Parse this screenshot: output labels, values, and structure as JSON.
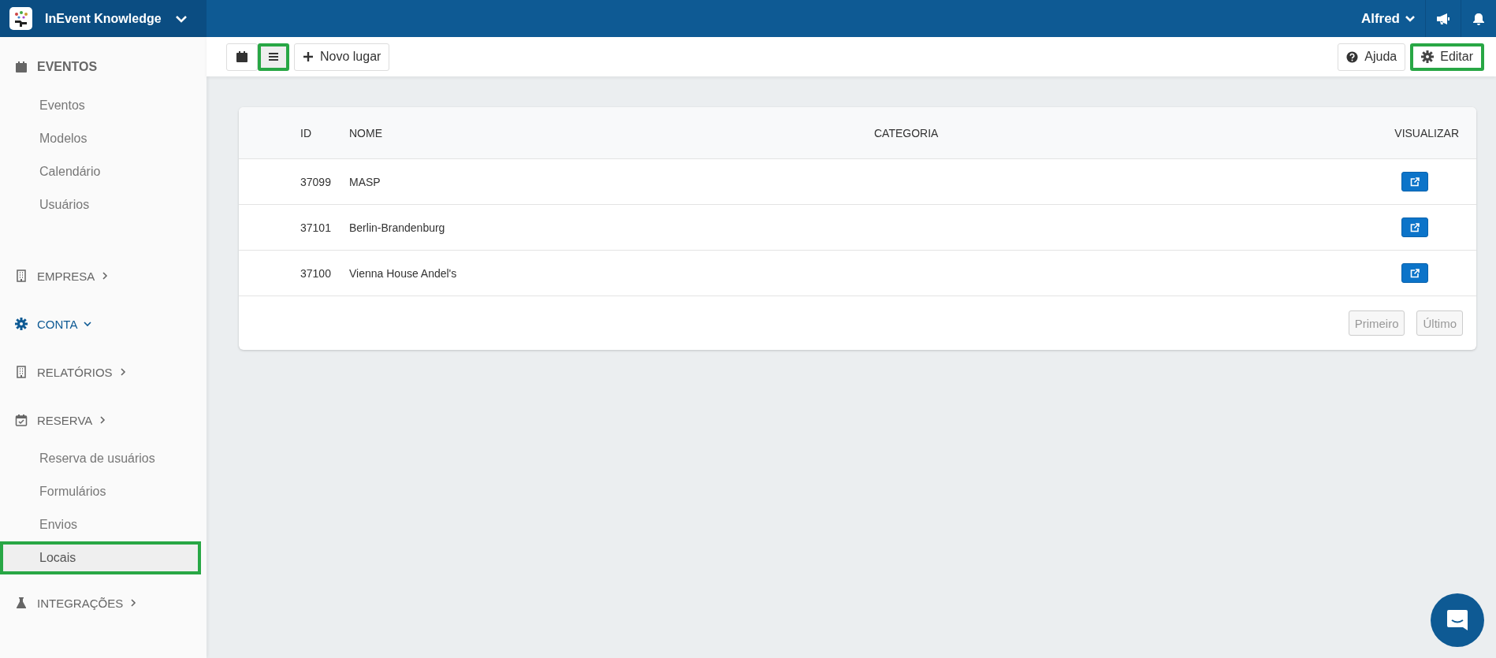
{
  "header": {
    "app_name": "InEvent Knowledge",
    "user": "Alfred"
  },
  "sidebar": {
    "sections": [
      {
        "label": "EVENTOS",
        "active": false,
        "items": [
          {
            "label": "Eventos",
            "selected": false,
            "highlighted": false
          },
          {
            "label": "Modelos",
            "selected": false,
            "highlighted": false
          },
          {
            "label": "Calendário",
            "selected": false,
            "highlighted": false
          },
          {
            "label": "Usuários",
            "selected": false,
            "highlighted": false
          }
        ]
      },
      {
        "label": "EMPRESA",
        "expanded": false,
        "active": false
      },
      {
        "label": "CONTA",
        "expanded": true,
        "active": true
      },
      {
        "label": "RELATÓRIOS",
        "expanded": false,
        "active": false
      },
      {
        "label": "RESERVA",
        "expanded": false,
        "active": false,
        "items": [
          {
            "label": "Reserva de usuários",
            "selected": false,
            "highlighted": false
          },
          {
            "label": "Formulários",
            "selected": false,
            "highlighted": false
          },
          {
            "label": "Envios",
            "selected": false,
            "highlighted": false
          },
          {
            "label": "Locais",
            "selected": true,
            "highlighted": true
          }
        ]
      },
      {
        "label": "INTEGRAÇÕES",
        "expanded": false,
        "active": false
      }
    ]
  },
  "toolbar": {
    "view_buttons": [
      {
        "selected": false,
        "highlighted": false
      },
      {
        "selected": true,
        "highlighted": true
      }
    ],
    "new_button": "Novo lugar",
    "help_button": {
      "label": "Ajuda",
      "highlighted": false
    },
    "edit_button": {
      "label": "Editar",
      "highlighted": true
    }
  },
  "table": {
    "columns": [
      "ID",
      "NOME",
      "CATEGORIA",
      "VISUALIZAR"
    ],
    "rows": [
      {
        "id": "37099",
        "name": "MASP"
      },
      {
        "id": "37101",
        "name": "Berlin-Brandenburg"
      },
      {
        "id": "37100",
        "name": "Vienna House Andel's"
      }
    ],
    "pagination": [
      {
        "label": "Primeiro",
        "disabled": true
      },
      {
        "label": "Último",
        "disabled": true
      }
    ]
  }
}
